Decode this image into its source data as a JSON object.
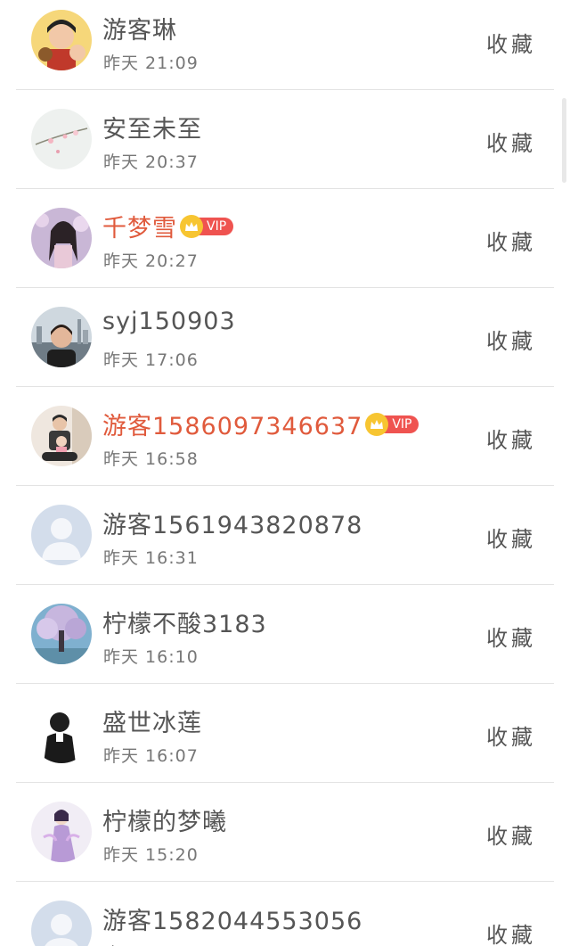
{
  "list": {
    "action_label": "收藏",
    "items": [
      {
        "name": "游客琳",
        "time": "昨天 21:09",
        "vip": false,
        "avatar": "cartoon-avatar-icon"
      },
      {
        "name": "安至未至",
        "time": "昨天 20:37",
        "vip": false,
        "avatar": "blossom-avatar-icon"
      },
      {
        "name": "千梦雪",
        "time": "昨天 20:27",
        "vip": true,
        "vip_label": "VIP",
        "avatar": "girl-avatar-icon"
      },
      {
        "name": "syj150903",
        "time": "昨天 17:06",
        "vip": false,
        "avatar": "city-avatar-icon"
      },
      {
        "name": "游客15860973466​37",
        "time": "昨天 16:58",
        "vip": true,
        "vip_label": "VIP",
        "avatar": "family-avatar-icon"
      },
      {
        "name": "游客1561943820878",
        "time": "昨天 16:31",
        "vip": false,
        "avatar": "default-avatar-icon"
      },
      {
        "name": "柠檬不酸3183",
        "time": "昨天 16:10",
        "vip": false,
        "avatar": "tree-avatar-icon"
      },
      {
        "name": "盛世冰莲",
        "time": "昨天 16:07",
        "vip": false,
        "avatar": "sketch-avatar-icon"
      },
      {
        "name": "柠檬的梦曦",
        "time": "昨天 15:20",
        "vip": false,
        "avatar": "costume-avatar-icon"
      },
      {
        "name": "游客1582044553056",
        "time": "昨天",
        "vip": false,
        "avatar": "default-avatar-icon"
      }
    ]
  },
  "colors": {
    "vip_name": "#e05a3c",
    "vip_badge": "#ef5350",
    "crown": "#f7c531",
    "divider": "#e3e3e3"
  }
}
